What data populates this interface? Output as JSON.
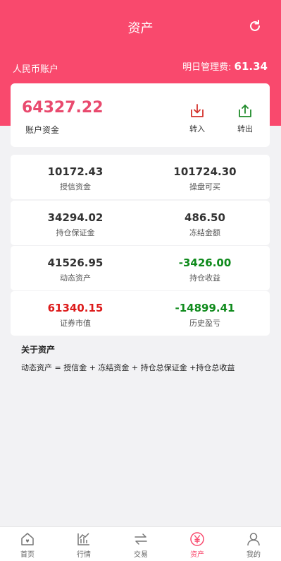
{
  "header": {
    "title": "资产",
    "account_label": "人民币账户",
    "fee_label": "明日管理费:",
    "fee_value": "61.34"
  },
  "balance": {
    "amount": "64327.22",
    "label": "账户资金",
    "transfer_in": "转入",
    "transfer_out": "转出"
  },
  "stats": [
    {
      "left": {
        "value": "10172.43",
        "label": "授信资金"
      },
      "right": {
        "value": "101724.30",
        "label": "操盘可买"
      }
    },
    {
      "left": {
        "value": "34294.02",
        "label": "持仓保证金"
      },
      "right": {
        "value": "486.50",
        "label": "冻结金额"
      }
    },
    {
      "left": {
        "value": "41526.95",
        "label": "动态资产"
      },
      "right": {
        "value": "-3426.00",
        "label": "持仓收益"
      }
    },
    {
      "left": {
        "value": "61340.15",
        "label": "证券市值"
      },
      "right": {
        "value": "-14899.41",
        "label": "历史盈亏"
      }
    }
  ],
  "about": {
    "title": "关于资产",
    "text": "动态资产 = 授信金 + 冻结资金 + 持仓总保证金 +持仓总收益"
  },
  "tabbar": [
    {
      "label": "首页",
      "icon": "home-icon"
    },
    {
      "label": "行情",
      "icon": "chart-icon"
    },
    {
      "label": "交易",
      "icon": "exchange-icon"
    },
    {
      "label": "资产",
      "icon": "yen-icon"
    },
    {
      "label": "我的",
      "icon": "user-icon"
    }
  ],
  "colors": {
    "brand": "#f9496d",
    "balance_amount": "#e94a6e",
    "positive": "#dd1a1a",
    "negative": "#0e8a1b",
    "transfer_in": "#d4322c",
    "transfer_out": "#1f8a2a"
  }
}
